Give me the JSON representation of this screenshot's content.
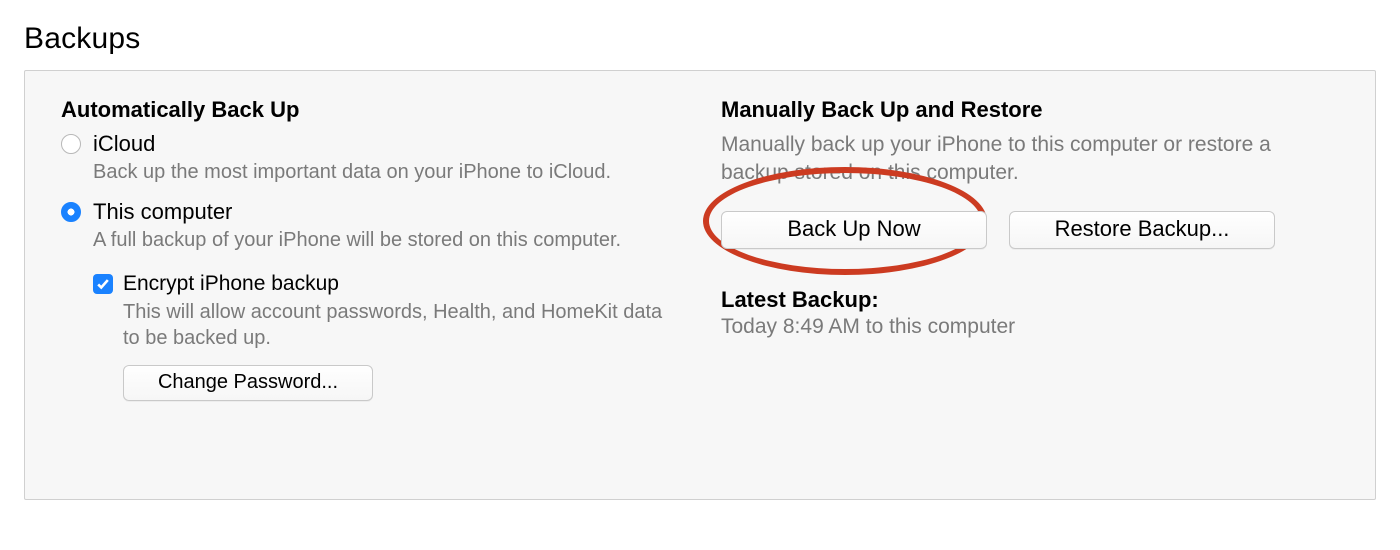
{
  "section_title": "Backups",
  "left": {
    "heading": "Automatically Back Up",
    "icloud": {
      "label": "iCloud",
      "desc": "Back up the most important data on your iPhone to iCloud."
    },
    "this_computer": {
      "label": "This computer",
      "desc": "A full backup of your iPhone will be stored on this computer."
    },
    "encrypt": {
      "label": "Encrypt iPhone backup",
      "desc": "This will allow account passwords, Health, and HomeKit data to be backed up."
    },
    "change_password_label": "Change Password..."
  },
  "right": {
    "heading": "Manually Back Up and Restore",
    "desc": "Manually back up your iPhone to this computer or restore a backup stored on this computer.",
    "back_up_now_label": "Back Up Now",
    "restore_backup_label": "Restore Backup...",
    "latest_heading": "Latest Backup:",
    "latest_value": "Today 8:49 AM to this computer"
  }
}
